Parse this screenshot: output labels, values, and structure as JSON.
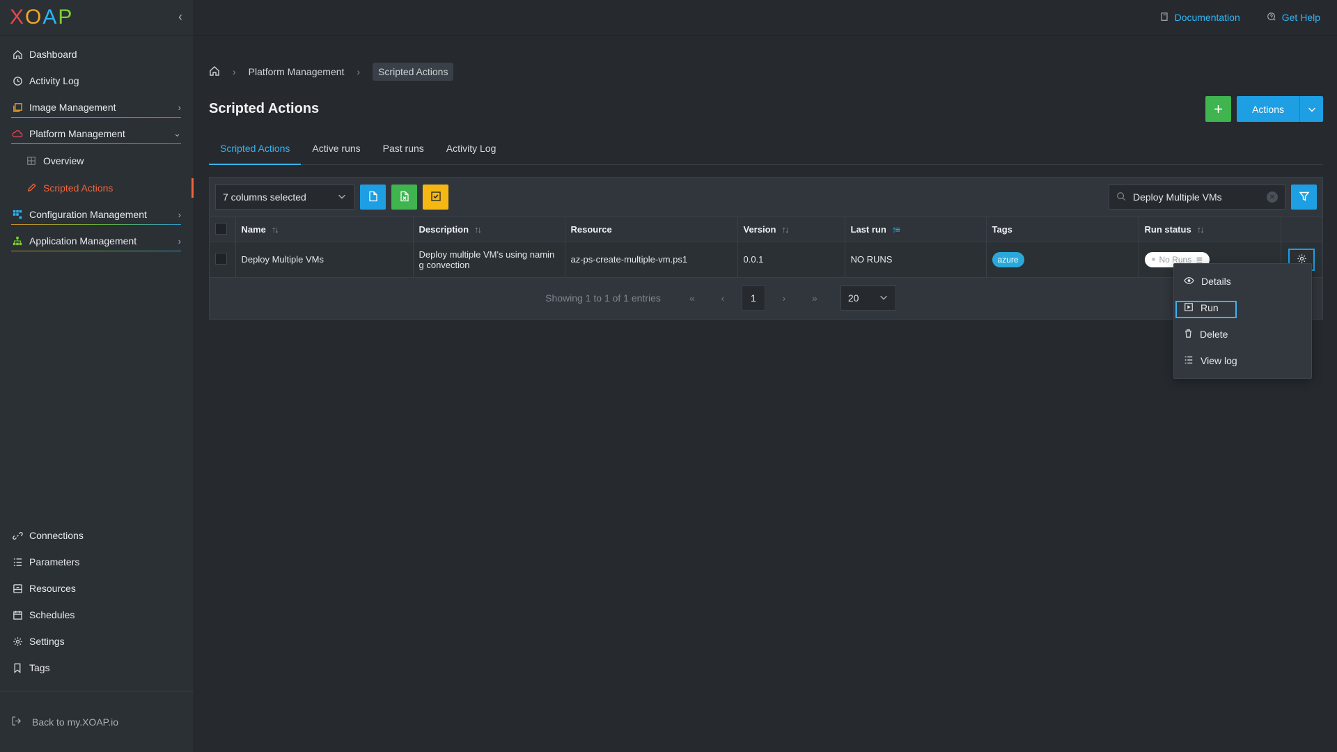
{
  "logo": {
    "letters": [
      "X",
      "O",
      "A",
      "P"
    ]
  },
  "sidebar": {
    "items": [
      {
        "label": "Dashboard",
        "icon": "home-icon"
      },
      {
        "label": "Activity Log",
        "icon": "clock-icon"
      },
      {
        "label": "Image Management",
        "icon": "images-icon"
      },
      {
        "label": "Platform Management",
        "icon": "cloud-icon"
      },
      {
        "label": "Overview",
        "icon": "grid-icon"
      },
      {
        "label": "Scripted Actions",
        "icon": "pencil-icon"
      },
      {
        "label": "Configuration Management",
        "icon": "config-icon"
      },
      {
        "label": "Application Management",
        "icon": "apps-icon"
      }
    ],
    "bottom_items": [
      {
        "label": "Connections",
        "icon": "link-icon"
      },
      {
        "label": "Parameters",
        "icon": "list-icon"
      },
      {
        "label": "Resources",
        "icon": "resource-icon"
      },
      {
        "label": "Schedules",
        "icon": "calendar-icon"
      },
      {
        "label": "Settings",
        "icon": "gear-icon"
      },
      {
        "label": "Tags",
        "icon": "bookmark-icon"
      }
    ],
    "back_link": "Back to my.XOAP.io"
  },
  "topbar": {
    "documentation": "Documentation",
    "get_help": "Get Help"
  },
  "breadcrumb": {
    "parent": "Platform Management",
    "current": "Scripted Actions"
  },
  "page": {
    "title": "Scripted Actions",
    "add_label": "+",
    "actions_label": "Actions"
  },
  "tabs": [
    "Scripted Actions",
    "Active runs",
    "Past runs",
    "Activity Log"
  ],
  "toolbar": {
    "columns_selected": "7 columns selected",
    "search_value": "Deploy Multiple VMs"
  },
  "table": {
    "headers": [
      "Name",
      "Description",
      "Resource",
      "Version",
      "Last run",
      "Tags",
      "Run status"
    ],
    "rows": [
      {
        "name": "Deploy Multiple VMs",
        "description": "Deploy multiple VM's using namin g convection",
        "resource": "az-ps-create-multiple-vm.ps1",
        "version": "0.0.1",
        "last_run": "NO RUNS",
        "tag": "azure",
        "run_status": "No Runs"
      }
    ]
  },
  "pager": {
    "info": "Showing 1 to 1 of 1 entries",
    "current_page": "1",
    "per_page": "20"
  },
  "context_menu": [
    "Details",
    "Run",
    "Delete",
    "View log"
  ],
  "colors": {
    "accent": "#1e9fe4",
    "active_nav": "#f0643a",
    "add": "#3fb44f",
    "warn": "#f5b812"
  }
}
